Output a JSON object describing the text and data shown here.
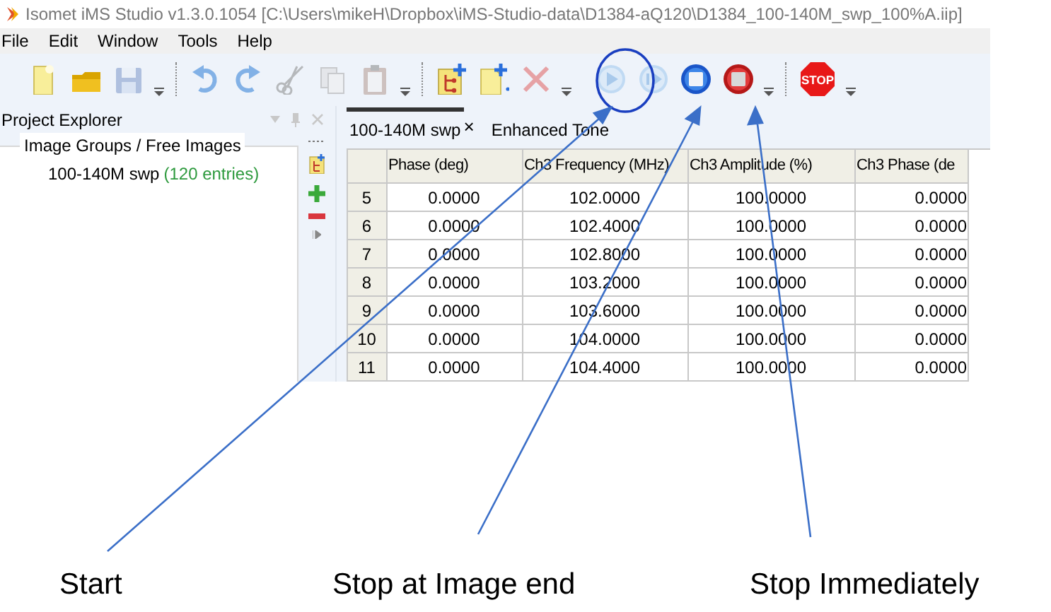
{
  "window": {
    "title": "Isomet iMS Studio v1.3.0.1054 [C:\\Users\\mikeH\\Dropbox\\iMS-Studio-data\\D1384-aQ120\\D1384_100-140M_swp_100%A.iip]"
  },
  "menu": [
    "File",
    "Edit",
    "Window",
    "Tools",
    "Help"
  ],
  "toolbar": [
    {
      "kind": "new",
      "disabled": false
    },
    {
      "kind": "open",
      "disabled": false
    },
    {
      "kind": "save",
      "disabled": true
    },
    {
      "kind": "dropdown"
    },
    {
      "kind": "separator"
    },
    {
      "kind": "undo",
      "disabled": true
    },
    {
      "kind": "redo",
      "disabled": true
    },
    {
      "kind": "cut",
      "disabled": true
    },
    {
      "kind": "copy",
      "disabled": true
    },
    {
      "kind": "paste",
      "disabled": true
    },
    {
      "kind": "dropdown"
    },
    {
      "kind": "separator"
    },
    {
      "kind": "tree-add",
      "disabled": false
    },
    {
      "kind": "new-add",
      "disabled": false
    },
    {
      "kind": "delete",
      "disabled": true
    },
    {
      "kind": "dropdown"
    },
    {
      "kind": "play",
      "disabled": true,
      "highlighted": true
    },
    {
      "kind": "step",
      "disabled": true
    },
    {
      "kind": "stop-end",
      "disabled": false
    },
    {
      "kind": "stop-now",
      "disabled": false
    },
    {
      "kind": "dropdown"
    },
    {
      "kind": "separator"
    },
    {
      "kind": "stop-sign",
      "disabled": false,
      "label": "STOP"
    },
    {
      "kind": "dropdown"
    }
  ],
  "project_explorer": {
    "title": "Project Explorer",
    "group": "Image Groups / Free Images",
    "items": [
      {
        "name": "100-140M swp",
        "count": "(120 entries)"
      }
    ]
  },
  "tabs": [
    {
      "label": "100-140M swp",
      "selected": true,
      "close": "×"
    },
    {
      "label": "Enhanced Tone",
      "selected": false
    }
  ],
  "table": {
    "columns": [
      "Phase (deg)",
      "Ch3 Frequency (MHz)",
      "Ch3 Amplitude (%)",
      "Ch3 Phase (de"
    ],
    "rows": [
      {
        "header": "5",
        "cells": [
          "0.0000",
          "102.0000",
          "100.0000",
          "0.0000"
        ]
      },
      {
        "header": "6",
        "cells": [
          "0.0000",
          "102.4000",
          "100.0000",
          "0.0000"
        ]
      },
      {
        "header": "7",
        "cells": [
          "0.0000",
          "102.8000",
          "100.0000",
          "0.0000"
        ]
      },
      {
        "header": "8",
        "cells": [
          "0.0000",
          "103.2000",
          "100.0000",
          "0.0000"
        ]
      },
      {
        "header": "9",
        "cells": [
          "0.0000",
          "103.6000",
          "100.0000",
          "0.0000"
        ]
      },
      {
        "header": "10",
        "cells": [
          "0.0000",
          "104.0000",
          "100.0000",
          "0.0000"
        ]
      },
      {
        "header": "11",
        "cells": [
          "0.0000",
          "104.4000",
          "100.0000",
          "0.0000"
        ]
      }
    ]
  },
  "annotations": [
    {
      "label": "Start"
    },
    {
      "label": "Stop at Image end"
    },
    {
      "label": "Stop Immediately"
    }
  ]
}
